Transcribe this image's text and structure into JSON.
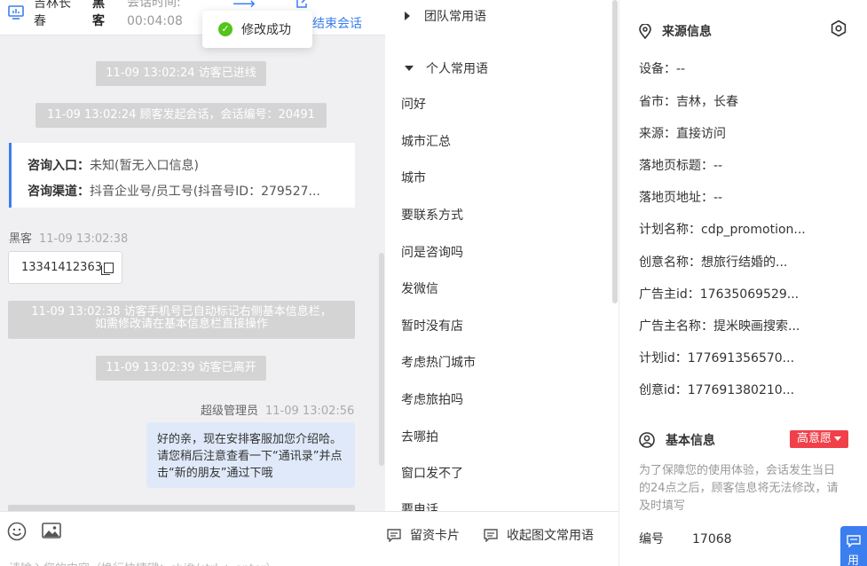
{
  "header": {
    "location": "吉林长春",
    "visitor_type": "黑客",
    "time_label": "会话时间:",
    "duration": "00:04:08",
    "transfer_icon": "transfer-arrow-icon",
    "end_label": "结束会话"
  },
  "toast": {
    "text": "修改成功",
    "icon": "check-circle-icon"
  },
  "chat": {
    "sys1": "11-09 13:02:24 访客已进线",
    "sys2": "11-09 13:02:24 顾客发起会话，会话编号：20491",
    "card": {
      "entry_label": "咨询入口：",
      "entry_value": "未知(暂无入口信息)",
      "channel_label": "咨询渠道：",
      "channel_value": "抖音企业号/员工号(抖音号ID：279527..."
    },
    "msg1": {
      "sender": "黑客",
      "time": "11-09 13:02:38",
      "text": "13341412363"
    },
    "sys3_line1": "11-09 13:02:38 访客手机号已自动标记右侧基本信息栏，",
    "sys3_line2": "如需修改请在基本信息栏直接操作",
    "sys4": "11-09 13:02:39 访客已离开",
    "msg2": {
      "sender": "超级管理员",
      "time": "11-09 13:02:56",
      "text": "好的亲，现在安排客服加您介绍哈。请您稍后注意查看一下“通讯录”并点击“新的朋友”通过下哦"
    }
  },
  "input": {
    "placeholder": "请输入您的内容（换行快捷键：shift/ctrl + enter）",
    "card_btn": "留资卡片",
    "collapse_btn": "收起图文常用语"
  },
  "phrases": {
    "team_group": "团队常用语",
    "personal_group": "个人常用语",
    "items": [
      "问好",
      "城市汇总",
      "城市",
      "要联系方式",
      "问是咨询吗",
      "发微信",
      "暂时没有店",
      "考虑热门城市",
      "考虑旅拍吗",
      "去哪拍",
      "窗口发不了",
      "要电话"
    ]
  },
  "info": {
    "source_title": "来源信息",
    "fields": [
      "设备：--",
      "省市：吉林，长春",
      "来源：直接访问",
      "落地页标题：--",
      "落地页地址：--",
      "计划名称：cdp_promotion...",
      "创意名称：想旅行结婚的...",
      "广告主id：17635069529...",
      "广告主名称：提米映画搜索...",
      "计划id：177691356570...",
      "创意id：177691380210..."
    ],
    "basic_title": "基本信息",
    "intent_badge": "高意愿",
    "note": "为了保障您的使用体验，会话发生当日的24点之后，顾客信息将无法修改，请及时填写",
    "id_label": "编号",
    "id_value": "17068",
    "float_label": "用"
  },
  "colors": {
    "accent": "#3a7ef0",
    "badge": "#f0404a",
    "bubble": "#dfe9f9",
    "system_msg": "#d4d4d4"
  }
}
